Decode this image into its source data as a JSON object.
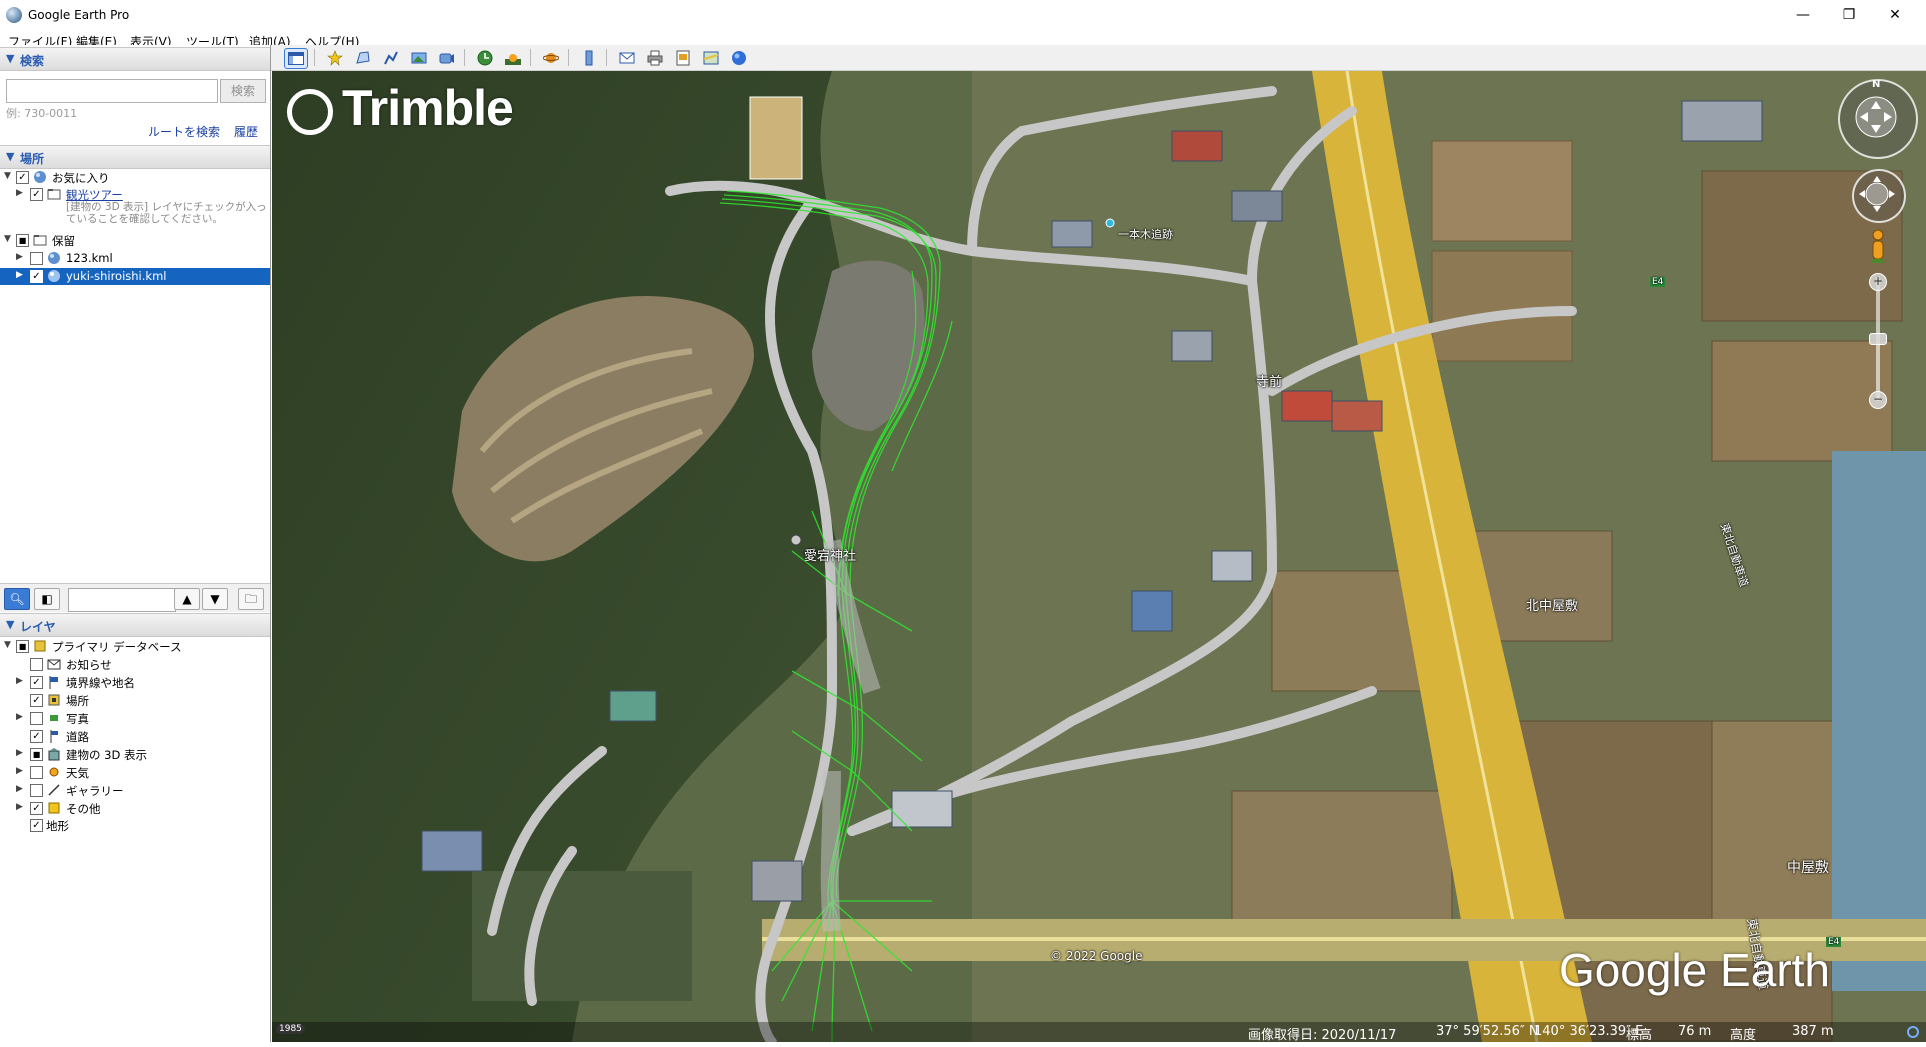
{
  "window": {
    "title": "Google Earth Pro",
    "controls": [
      "—",
      "❐",
      "✕"
    ]
  },
  "menu": [
    "ファイル(F)",
    "編集(E)",
    "表示(V)",
    "ツール(T)",
    "追加(A)",
    "ヘルプ(H)"
  ],
  "search": {
    "header": "検索",
    "placeholder": "",
    "button": "検索",
    "hint": "例: 730-0011",
    "route_link": "ルートを検索",
    "history_link": "履歴"
  },
  "places": {
    "header": "場所",
    "items": [
      {
        "label": "お気に入り",
        "checked": true
      },
      {
        "label": "観光ツアー",
        "checked": true
      },
      {
        "label": "[建物の 3D 表示] レイヤにチェックが入っていることを確認してください。"
      },
      {
        "label": "保留",
        "checked": "partial"
      },
      {
        "label": "123.kml",
        "checked": false
      },
      {
        "label": "yuki-shiroishi.kml",
        "checked": true,
        "selected": true
      }
    ]
  },
  "layers": {
    "header": "レイヤ",
    "items": [
      {
        "label": "プライマリ データベース",
        "checked": "partial"
      },
      {
        "label": "お知らせ",
        "checked": false
      },
      {
        "label": "境界線や地名",
        "checked": true
      },
      {
        "label": "場所",
        "checked": true
      },
      {
        "label": "写真",
        "checked": false
      },
      {
        "label": "道路",
        "checked": true
      },
      {
        "label": "建物の 3D 表示",
        "checked": "partial"
      },
      {
        "label": "天気",
        "checked": false
      },
      {
        "label": "ギャラリー",
        "checked": false
      },
      {
        "label": "その他",
        "checked": true
      },
      {
        "label": "地形",
        "checked": true
      }
    ]
  },
  "map": {
    "watermark": "Trimble",
    "brand": "Google Earth",
    "copyright": "© 2022 Google",
    "north": "N",
    "labels": {
      "ipponki": "一本木追跡",
      "temamae": "寺前",
      "atago": "愛宕神社",
      "kitanakayashiki": "北中屋敷",
      "nakayashiki": "中屋敷",
      "expressway_1": "東北自動車道",
      "expressway_2": "東北自動車道",
      "e4_1": "E4",
      "e4_2": "E4"
    },
    "status": {
      "year": "1985",
      "image_date": "画像取得日: 2020/11/17",
      "lat": "37° 59′52.56″ N",
      "lon": "140° 36′23.39″ E",
      "elev_label": "標高",
      "elev": "76 m",
      "alt_label": "高度",
      "alt": "387 m"
    }
  },
  "colors": {
    "selection": "#1565c0",
    "track": "#2ee82e",
    "expressway": "#e8c23a",
    "link": "#1a3fa0"
  }
}
